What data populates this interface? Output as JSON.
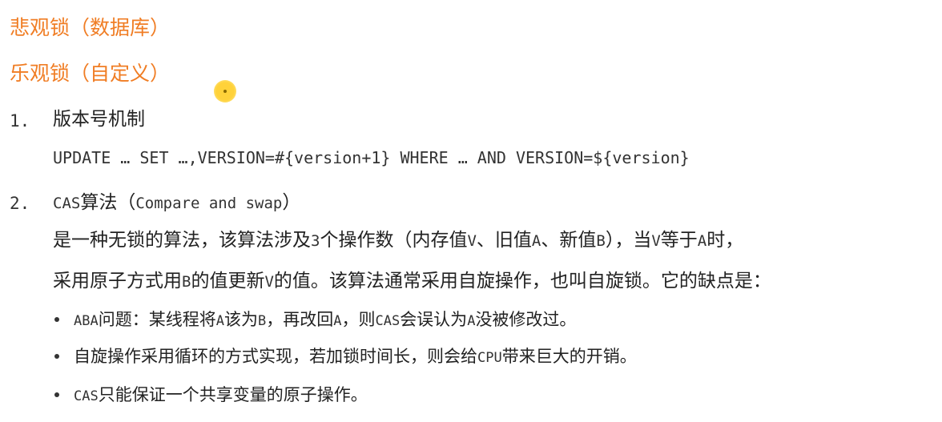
{
  "headings": {
    "pessimistic": "悲观锁（数据库）",
    "optimistic": "乐观锁（自定义）"
  },
  "item1": {
    "number": "1.",
    "title": "版本号机制",
    "code": "UPDATE … SET …,VERSION=#{version+1} WHERE … AND VERSION=${version}"
  },
  "item2": {
    "number": "2.",
    "title_a": "CAS",
    "title_b": "算法（",
    "title_c": "Compare and swap",
    "title_d": "）",
    "desc1": {
      "t1": "是一种无锁的算法，该算法涉及",
      "t2": "3",
      "t3": "个操作数（内存值",
      "t4": "V",
      "t5": "、旧值",
      "t6": "A",
      "t7": "、新值",
      "t8": "B",
      "t9": "），当",
      "t10": "V",
      "t11": "等于",
      "t12": "A",
      "t13": "时，"
    },
    "desc2": {
      "t1": "采用原子方式用",
      "t2": "B",
      "t3": "的值更新",
      "t4": "V",
      "t5": "的值。该算法通常采用自旋操作，也叫自旋锁。它的缺点是："
    },
    "bullets": {
      "b1": {
        "t1": "ABA",
        "t2": "问题：某线程将",
        "t3": "A",
        "t4": "该为",
        "t5": "B",
        "t6": "，再改回",
        "t7": "A",
        "t8": "，则",
        "t9": "CAS",
        "t10": "会误认为",
        "t11": "A",
        "t12": "没被修改过。"
      },
      "b2": {
        "t1": "自旋操作采用循环的方式实现，若加锁时间长，则会给",
        "t2": "CPU",
        "t3": "带来巨大的开销。"
      },
      "b3": {
        "t1": "CAS",
        "t2": "只能保证一个共享变量的原子操作。"
      }
    }
  },
  "colors": {
    "heading": "#f07d24",
    "text": "#222222",
    "cursor": "#ffd23a"
  }
}
